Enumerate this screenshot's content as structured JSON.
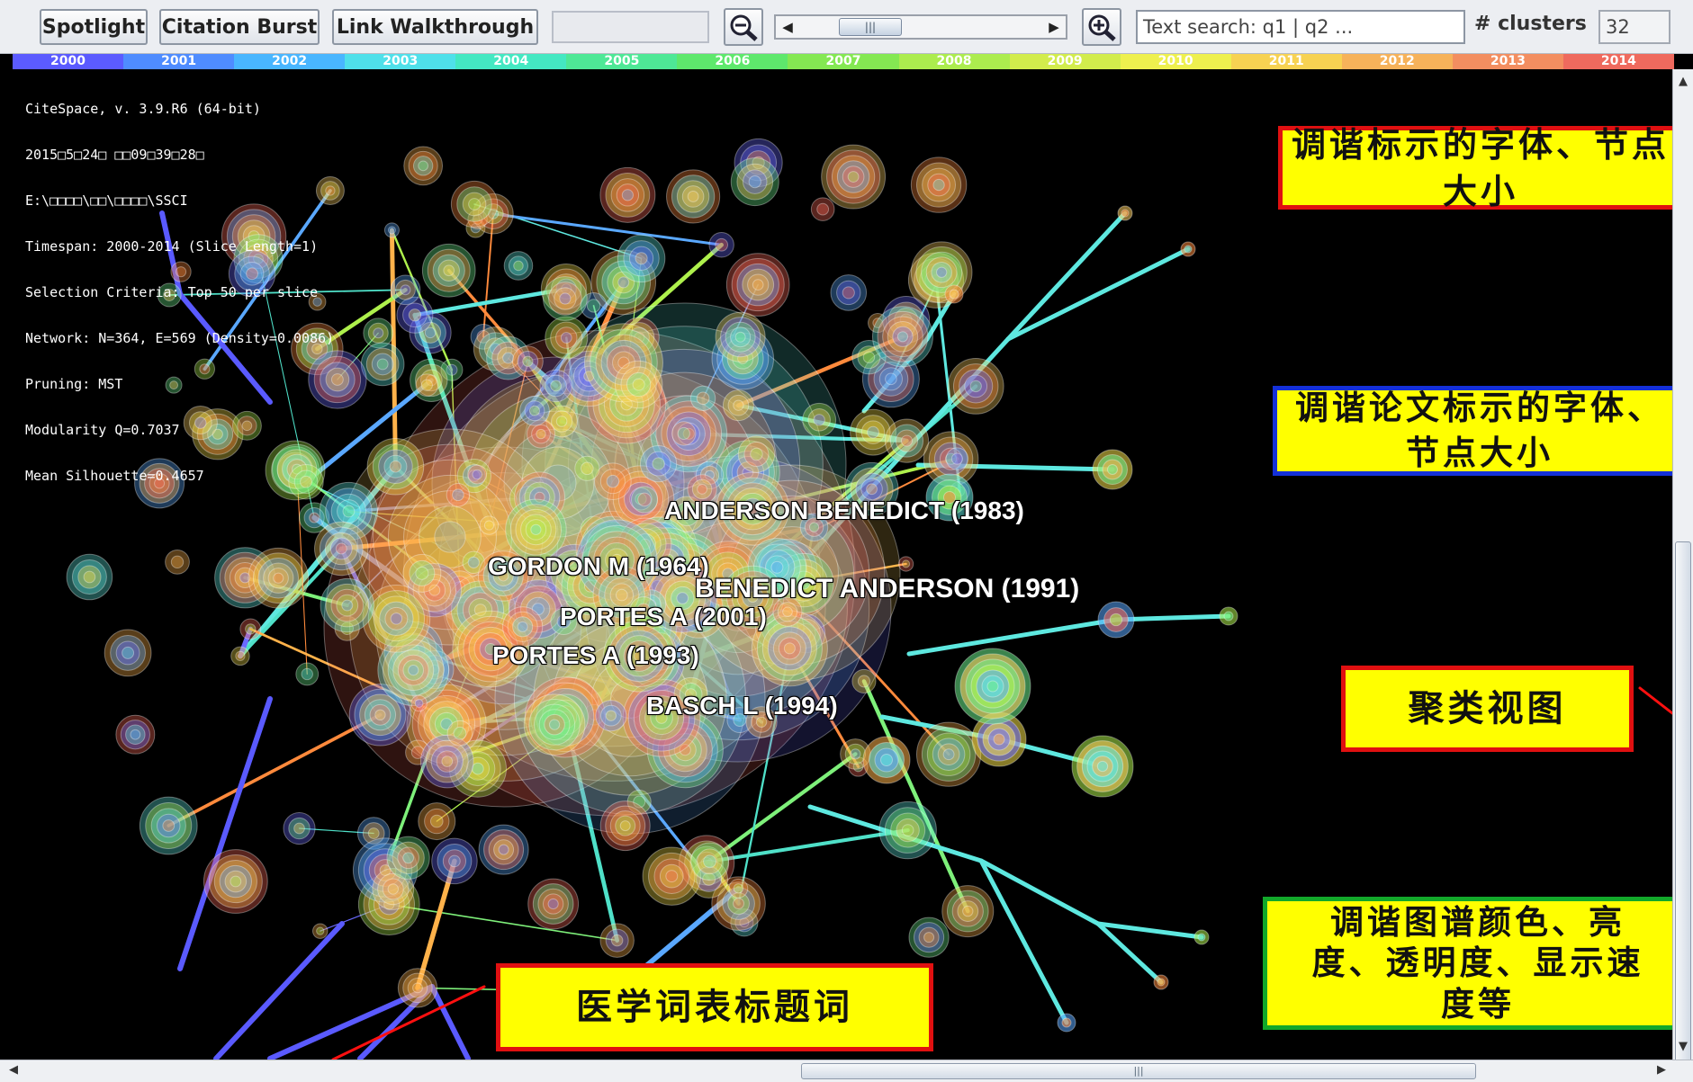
{
  "toolbar": {
    "spotlight": "Spotlight",
    "citation_burst": "Citation Burst",
    "link_walkthrough": "Link Walkthrough",
    "search_placeholder": "Text search: q1 | q2 ...",
    "clusters_label": "# clusters",
    "clusters_value": "32"
  },
  "timeline": {
    "years": [
      "2000",
      "2001",
      "2002",
      "2003",
      "2004",
      "2005",
      "2006",
      "2007",
      "2008",
      "2009",
      "2010",
      "2011",
      "2012",
      "2013",
      "2014"
    ],
    "colors": [
      "#5b5bff",
      "#4f8cff",
      "#49b6ff",
      "#4fe0ea",
      "#44e8c2",
      "#4ee896",
      "#5ee86c",
      "#84e852",
      "#acec4e",
      "#d2ec4c",
      "#eef04e",
      "#f7d252",
      "#f6b25a",
      "#f38e60",
      "#ef6a5e"
    ]
  },
  "info": [
    "CiteSpace, v. 3.9.R6 (64-bit)",
    "2015□5□24□ □□09□39□28□",
    "E:\\□□□□\\□□\\□□□□\\SSCI",
    "Timespan: 2000-2014 (Slice Length=1)",
    "Selection Criteria: Top 50 per slice",
    "Network: N=364, E=569 (Density=0.0086)",
    "Pruning: MST",
    "Modularity Q=0.7037",
    "Mean Silhouette=0.4657"
  ],
  "labels": [
    "ANDERSON BENEDICT (1983)",
    "GORDON M (1964)",
    "BENEDICT ANDERSON (1991)",
    "PORTES A (2001)",
    "PORTES A (1993)",
    "BASCH L (1994)"
  ],
  "callouts": {
    "font_node_size": "调谐标示的字体、节点大小",
    "paper_label_font": "调谐论文标示的字体、节点大小",
    "cluster_view": "聚类视图",
    "color_brightness": "调谐图谱颜色、亮度、透明度、显示速度等",
    "mesh_terms": "医学词表标题词"
  }
}
